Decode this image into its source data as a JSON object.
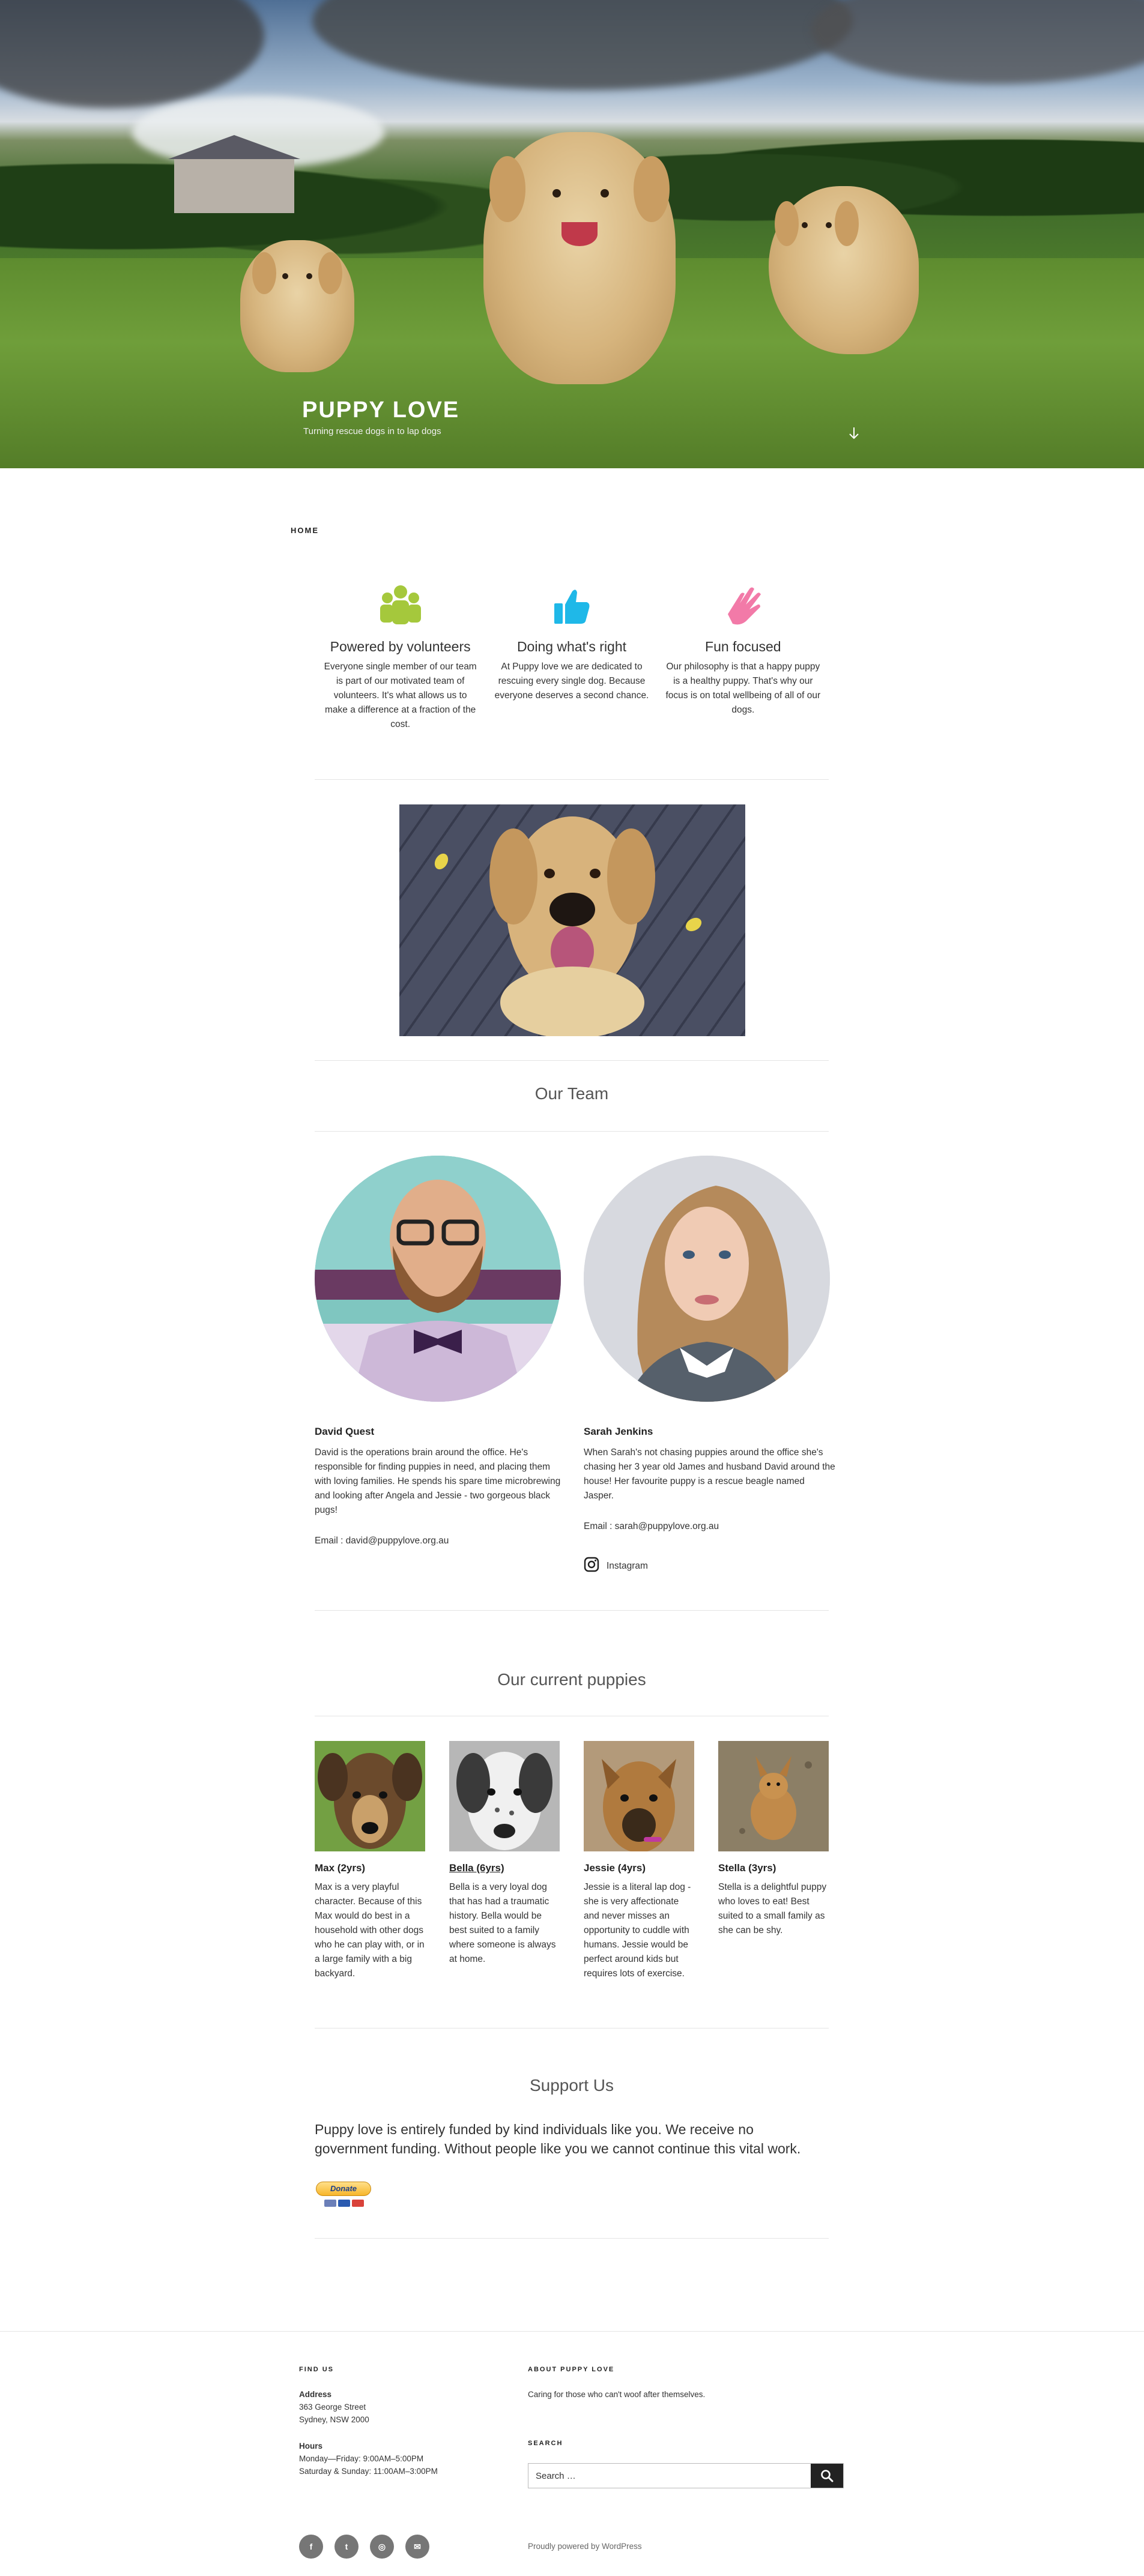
{
  "site": {
    "title": "PUPPY LOVE",
    "description": "Turning rescue dogs in to lap dogs"
  },
  "nav": {
    "items": [
      {
        "label": "HOME"
      }
    ]
  },
  "features": [
    {
      "icon": "group-icon",
      "color": "#a5c83c",
      "title": "Powered by volunteers",
      "text": "Everyone single member of our team is part of our motivated team of volunteers. It's what allows us to make a difference at a fraction of the cost."
    },
    {
      "icon": "thumbs-up-icon",
      "color": "#1fb8e8",
      "title": "Doing what's right",
      "text": "At Puppy love we are dedicated to rescuing every single dog. Because everyone deserves a second chance."
    },
    {
      "icon": "hand-icon",
      "color": "#f27aa8",
      "title": "Fun focused",
      "text": "Our philosophy is that a happy puppy is a healthy puppy. That's why our focus is on total wellbeing of all of our dogs."
    }
  ],
  "team": {
    "heading": "Our Team",
    "members": [
      {
        "name": "David Quest",
        "bio": "David is the operations brain around the office. He's responsible for finding puppies in need, and placing them with loving families. He spends his spare time microbrewing and looking after Angela and Jessie - two gorgeous black pugs!",
        "email": "Email : david@puppylove.org.au"
      },
      {
        "name": "Sarah Jenkins",
        "bio": "When Sarah's not chasing puppies around the office she's chasing her 3 year old James and husband David around the house! Her favourite puppy is a rescue beagle named Jasper.",
        "email": "Email : sarah@puppylove.org.au",
        "social": "Instagram"
      }
    ]
  },
  "puppies": {
    "heading": "Our current puppies",
    "items": [
      {
        "name": "Max (2yrs)",
        "text": "Max is a very playful character. Because of this Max would do best in a household with other dogs who he can play with, or in a large family with a big backyard."
      },
      {
        "name": "Bella (6yrs)",
        "text": "Bella is a very loyal dog that has had a traumatic history. Bella would be best suited to a family where someone is always at home."
      },
      {
        "name": "Jessie (4yrs)",
        "text": "Jessie is a literal lap dog - she is very affectionate and never misses an opportunity to cuddle with humans. Jessie would be perfect around kids but requires lots of exercise."
      },
      {
        "name": "Stella (3yrs)",
        "text": "Stella is a delightful puppy who loves to eat! Best suited to a small family as she can be shy."
      }
    ]
  },
  "support": {
    "heading": "Support Us",
    "text": "Puppy love is entirely funded by kind individuals like you. We receive no government funding. Without people like you we cannot continue this vital work.",
    "donate_label": "Donate"
  },
  "footer": {
    "find_us": {
      "heading": "FIND US",
      "address_label": "Address",
      "address_line1": "363 George Street",
      "address_line2": "Sydney, NSW 2000",
      "hours_label": "Hours",
      "hours_line1": "Monday—Friday: 9:00AM–5:00PM",
      "hours_line2": "Saturday & Sunday: 11:00AM–3:00PM"
    },
    "about": {
      "heading": "ABOUT PUPPY LOVE",
      "text": "Caring for those who can't woof after themselves."
    },
    "search": {
      "heading": "SEARCH",
      "placeholder": "Search …"
    },
    "social_icons": [
      "facebook-icon",
      "twitter-icon",
      "instagram-icon",
      "email-icon"
    ],
    "social_glyphs": [
      "f",
      "t",
      "◎",
      "✉"
    ],
    "powered": "Proudly powered by WordPress"
  }
}
